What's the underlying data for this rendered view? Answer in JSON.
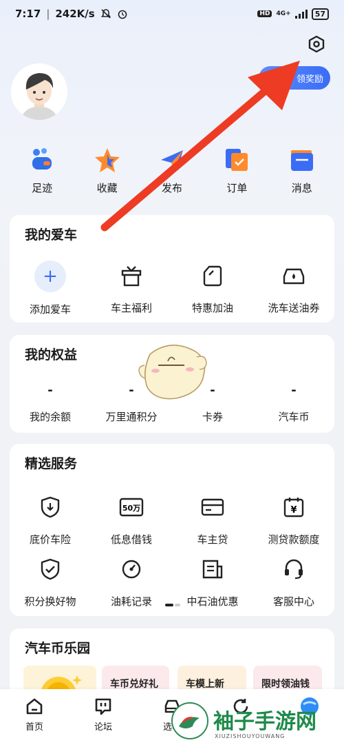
{
  "status": {
    "time": "7:17",
    "speed": "242K/s",
    "network": "4G+",
    "hd": "HD",
    "battery": "57"
  },
  "header": {
    "reward_label": "领奖励",
    "settings_icon": "gear-hex-icon"
  },
  "quick": [
    {
      "label": "足迹",
      "icon": "footprint-icon"
    },
    {
      "label": "收藏",
      "icon": "star-icon"
    },
    {
      "label": "发布",
      "icon": "send-icon"
    },
    {
      "label": "订单",
      "icon": "order-icon"
    },
    {
      "label": "消息",
      "icon": "message-icon"
    }
  ],
  "my_car": {
    "title": "我的爱车",
    "items": [
      {
        "label": "添加爱车",
        "icon": "plus-icon"
      },
      {
        "label": "车主福利",
        "icon": "gift-icon"
      },
      {
        "label": "特惠加油",
        "icon": "fuel-icon"
      },
      {
        "label": "洗车送油券",
        "icon": "car-wash-icon"
      }
    ]
  },
  "benefits": {
    "title": "我的权益",
    "items": [
      {
        "value": "-",
        "label": "我的余额"
      },
      {
        "value": "-",
        "label": "万里通积分"
      },
      {
        "value": "-",
        "label": "卡券"
      },
      {
        "value": "-",
        "label": "汽车币"
      }
    ]
  },
  "services": {
    "title": "精选服务",
    "row1": [
      {
        "label": "底价车险",
        "icon": "shield-down-icon"
      },
      {
        "label": "低息借钱",
        "icon": "money-50-icon",
        "icon_text": "50万"
      },
      {
        "label": "车主贷",
        "icon": "card-icon"
      },
      {
        "label": "测贷款额度",
        "icon": "calendar-yuan-icon",
        "icon_text": "¥"
      }
    ],
    "row2": [
      {
        "label": "积分换好物",
        "icon": "shield-check-icon"
      },
      {
        "label": "油耗记录",
        "icon": "gauge-icon"
      },
      {
        "label": "中石油优惠",
        "icon": "coupon-icon"
      },
      {
        "label": "客服中心",
        "icon": "headset-icon"
      }
    ]
  },
  "park": {
    "title": "汽车币乐园",
    "promos": [
      "车币兑好礼",
      "车模上新",
      "限时领油钱"
    ]
  },
  "nav": [
    {
      "label": "首页",
      "icon": "home-icon"
    },
    {
      "label": "论坛",
      "icon": "forum-icon"
    },
    {
      "label": "选车",
      "icon": "car-select-icon"
    },
    {
      "label": "",
      "icon": "refresh-icon"
    },
    {
      "label": "",
      "icon": "blue-ball-icon"
    }
  ],
  "watermark": {
    "text": "袖子手游网",
    "sub": "XIUZISHOUYOUWANG"
  }
}
